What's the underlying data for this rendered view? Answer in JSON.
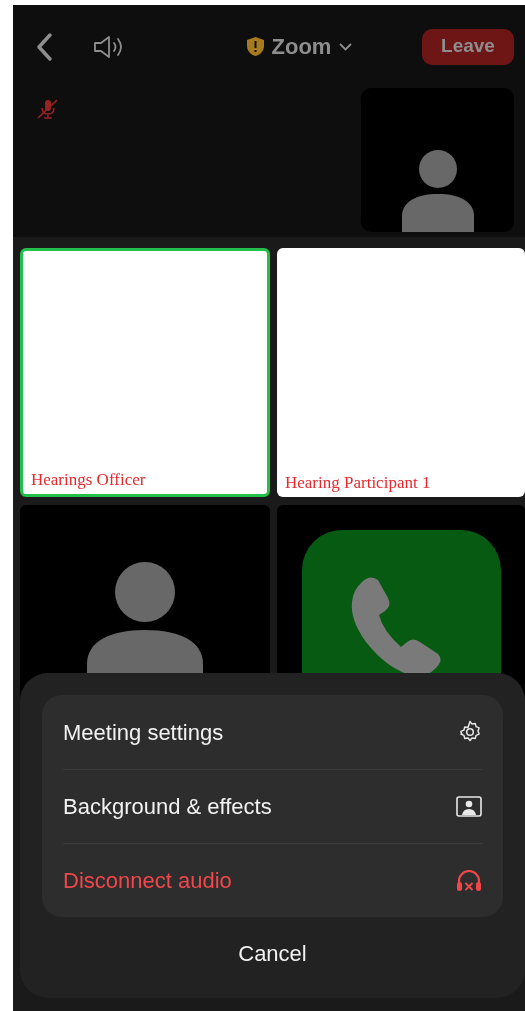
{
  "top_bar": {
    "title": "Zoom",
    "leave_button": "Leave"
  },
  "self_view": {
    "muted": true
  },
  "tiles": [
    {
      "kind": "video",
      "name": "Hearings Officer",
      "active_speaker": true
    },
    {
      "kind": "video",
      "name": "Hearing Participant 1",
      "active_speaker": false
    },
    {
      "kind": "avatar",
      "active_speaker": false
    },
    {
      "kind": "phone",
      "active_speaker": false
    }
  ],
  "sheet": {
    "items": [
      {
        "label": "Meeting settings",
        "kind": "settings",
        "destructive": false
      },
      {
        "label": "Background & effects",
        "kind": "background",
        "destructive": false
      },
      {
        "label": "Disconnect audio",
        "kind": "disconnect",
        "destructive": true
      }
    ],
    "cancel": "Cancel"
  }
}
